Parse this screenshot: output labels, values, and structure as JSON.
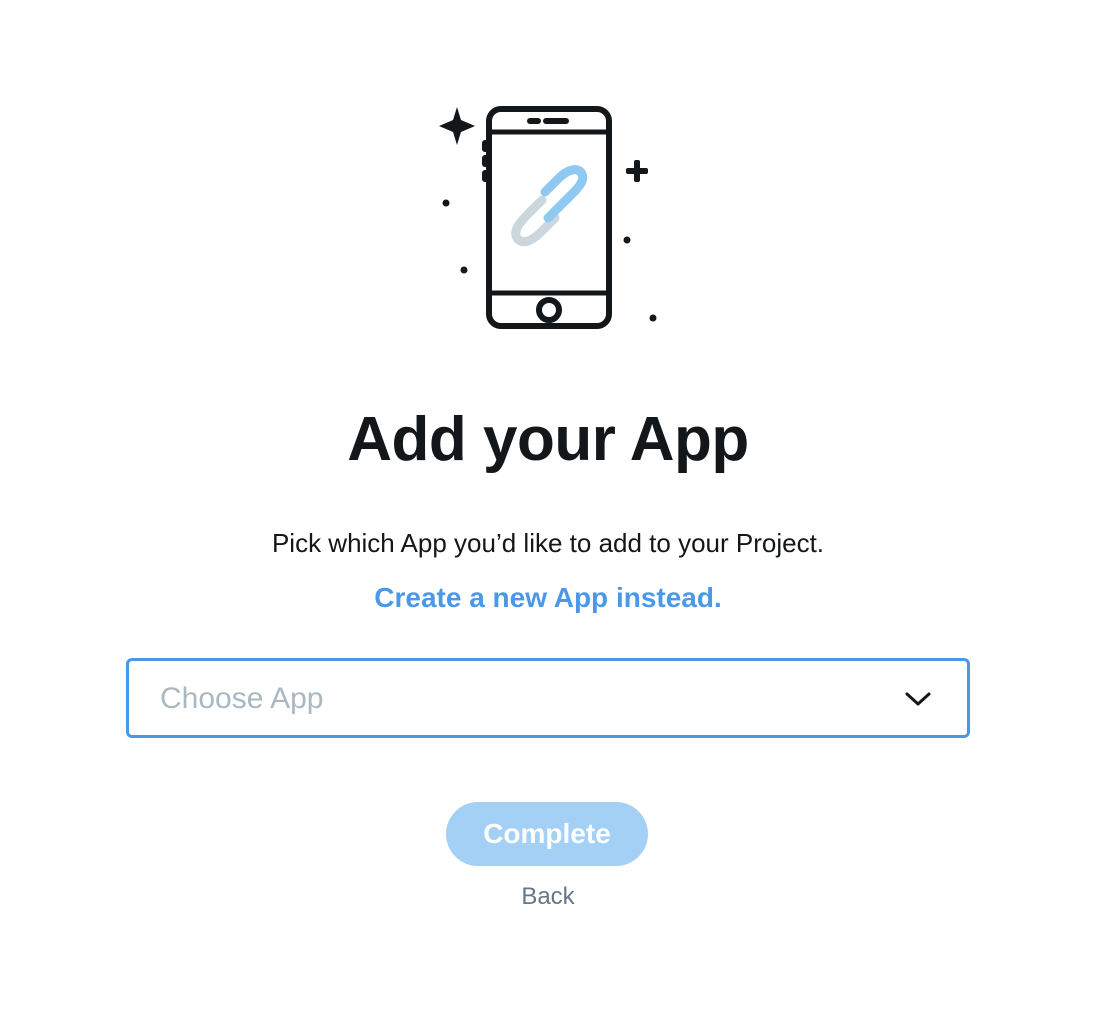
{
  "illustration": {
    "icon": "phone-with-link-icon",
    "accent_color": "#8fc8f1",
    "secondary_color": "#ccd6dd"
  },
  "title": "Add your App",
  "subtitle": "Pick which App you’d like to add to your Project.",
  "create_link": "Create a new App instead.",
  "app_select": {
    "placeholder": "Choose App",
    "value": ""
  },
  "actions": {
    "complete_label": "Complete",
    "back_label": "Back"
  },
  "colors": {
    "accent": "#4a99e9",
    "button_disabled": "#a5d0f6",
    "text": "#14171a",
    "muted": "#657786",
    "placeholder": "#aab8c2"
  }
}
